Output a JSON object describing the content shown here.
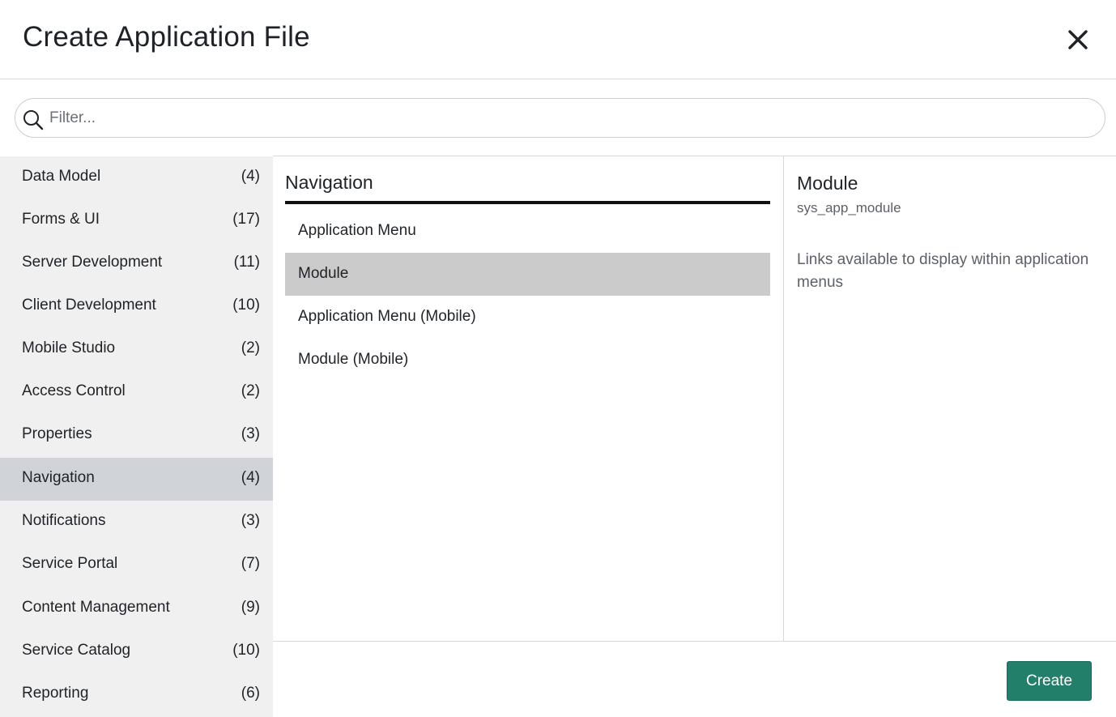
{
  "dialog": {
    "title": "Create Application File"
  },
  "search": {
    "placeholder": "Filter...",
    "value": ""
  },
  "categories": [
    {
      "label": "Data Model",
      "count": "(4)"
    },
    {
      "label": "Forms & UI",
      "count": "(17)"
    },
    {
      "label": "Server Development",
      "count": "(11)"
    },
    {
      "label": "Client Development",
      "count": "(10)"
    },
    {
      "label": "Mobile Studio",
      "count": "(2)"
    },
    {
      "label": "Access Control",
      "count": "(2)"
    },
    {
      "label": "Properties",
      "count": "(3)"
    },
    {
      "label": "Navigation",
      "count": "(4)"
    },
    {
      "label": "Notifications",
      "count": "(3)"
    },
    {
      "label": "Service Portal",
      "count": "(7)"
    },
    {
      "label": "Content Management",
      "count": "(9)"
    },
    {
      "label": "Service Catalog",
      "count": "(10)"
    },
    {
      "label": "Reporting",
      "count": "(6)"
    }
  ],
  "selected_category": "Navigation",
  "file_types": {
    "header": "Navigation",
    "items": [
      {
        "label": "Application Menu"
      },
      {
        "label": "Module"
      },
      {
        "label": "Application Menu (Mobile)"
      },
      {
        "label": "Module (Mobile)"
      }
    ],
    "selected": "Module"
  },
  "detail": {
    "title": "Module",
    "table": "sys_app_module",
    "description": "Links available to display within application menus"
  },
  "footer": {
    "create_label": "Create"
  },
  "colors": {
    "primary_button": "#22806a",
    "active_category_bg": "#d0d3d7",
    "selected_item_bg": "#cbcbcb",
    "sidebar_bg": "#f0f0f0"
  },
  "icons": {
    "close": "close-icon",
    "search": "search-icon"
  }
}
